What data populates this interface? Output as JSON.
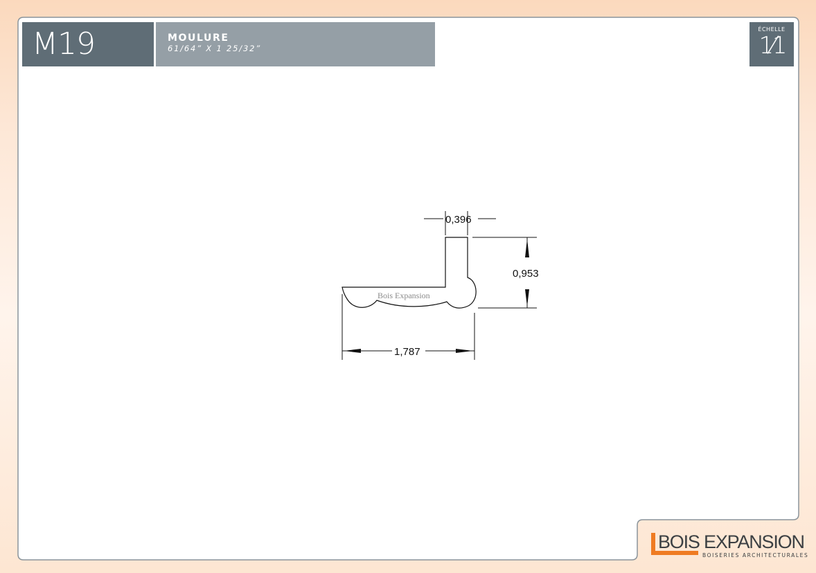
{
  "header": {
    "code": "M19",
    "title": "MOULURE",
    "subtitle": "61/64” X 1 25/32”"
  },
  "scale": {
    "label": "ÉCHELLE",
    "value": "1⁄1"
  },
  "drawing": {
    "watermark": "Bois Expansion",
    "dimensions": {
      "width_top": "0,396",
      "height": "0,953",
      "width_overall": "1,787"
    }
  },
  "logo": {
    "name": "BOIS EXPANSION",
    "tagline": "BOISERIES ARCHITECTURALES",
    "accent_color": "#ef7b22"
  },
  "colors": {
    "header_dark": "#5f6d76",
    "header_light": "#959fa6",
    "frame": "#7f8a92"
  }
}
